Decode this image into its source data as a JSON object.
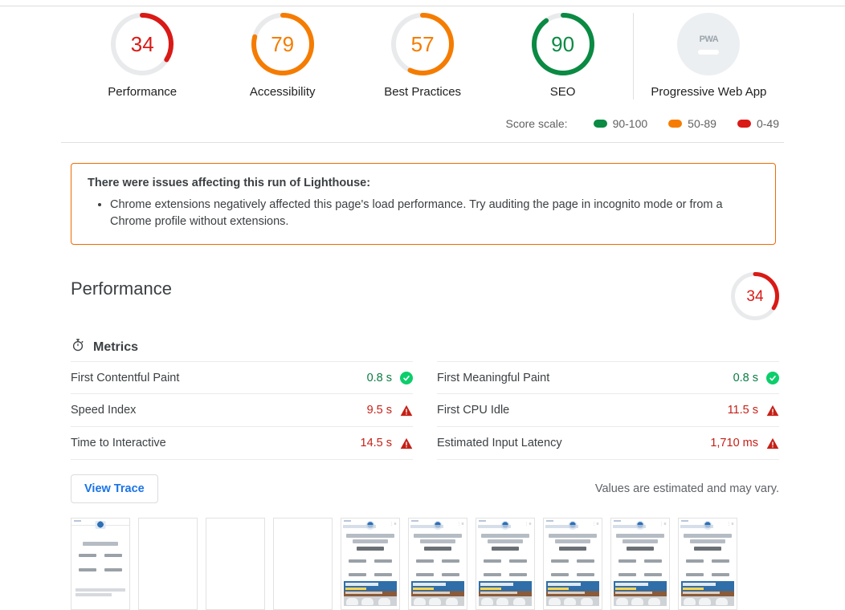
{
  "scores": {
    "categories": [
      {
        "label": "Performance",
        "value": 34,
        "color": "#d91a16",
        "track": "#e8eaec"
      },
      {
        "label": "Accessibility",
        "value": 79,
        "color": "#f57c00",
        "track": "#e8eaec"
      },
      {
        "label": "Best Practices",
        "value": 57,
        "color": "#f57c00",
        "track": "#e8eaec"
      },
      {
        "label": "SEO",
        "value": 90,
        "color": "#0a8a43",
        "track": "#e8eaec"
      }
    ],
    "pwa": {
      "label": "Progressive Web App",
      "badge_text": "PWA"
    }
  },
  "score_scale": {
    "label": "Score scale:",
    "items": [
      {
        "range": "90-100",
        "color": "#0a8a43"
      },
      {
        "range": "50-89",
        "color": "#f57c00"
      },
      {
        "range": "0-49",
        "color": "#d91a16"
      }
    ]
  },
  "warning": {
    "title": "There were issues affecting this run of Lighthouse:",
    "items": [
      "Chrome extensions negatively affected this page's load performance. Try auditing the page in incognito mode or from a Chrome profile without extensions."
    ],
    "border_color": "#ef6c00"
  },
  "performance": {
    "title": "Performance",
    "score": 34,
    "score_color": "#d91a16",
    "metrics_heading": "Metrics",
    "metrics_icon": "stopwatch-icon",
    "columns": [
      [
        {
          "name": "First Contentful Paint",
          "value": "0.8 s",
          "status": "pass"
        },
        {
          "name": "Speed Index",
          "value": "9.5 s",
          "status": "fail"
        },
        {
          "name": "Time to Interactive",
          "value": "14.5 s",
          "status": "fail"
        }
      ],
      [
        {
          "name": "First Meaningful Paint",
          "value": "0.8 s",
          "status": "pass"
        },
        {
          "name": "First CPU Idle",
          "value": "11.5 s",
          "status": "fail"
        },
        {
          "name": "Estimated Input Latency",
          "value": "1,710 ms",
          "status": "fail"
        }
      ]
    ],
    "view_trace_label": "View Trace",
    "estimate_note": "Values are estimated and may vary.",
    "filmstrip": [
      {
        "state": "partial"
      },
      {
        "state": "blank"
      },
      {
        "state": "blank"
      },
      {
        "state": "blank"
      },
      {
        "state": "loaded"
      },
      {
        "state": "loaded"
      },
      {
        "state": "loaded"
      },
      {
        "state": "loaded"
      },
      {
        "state": "loaded"
      },
      {
        "state": "loaded"
      }
    ]
  }
}
